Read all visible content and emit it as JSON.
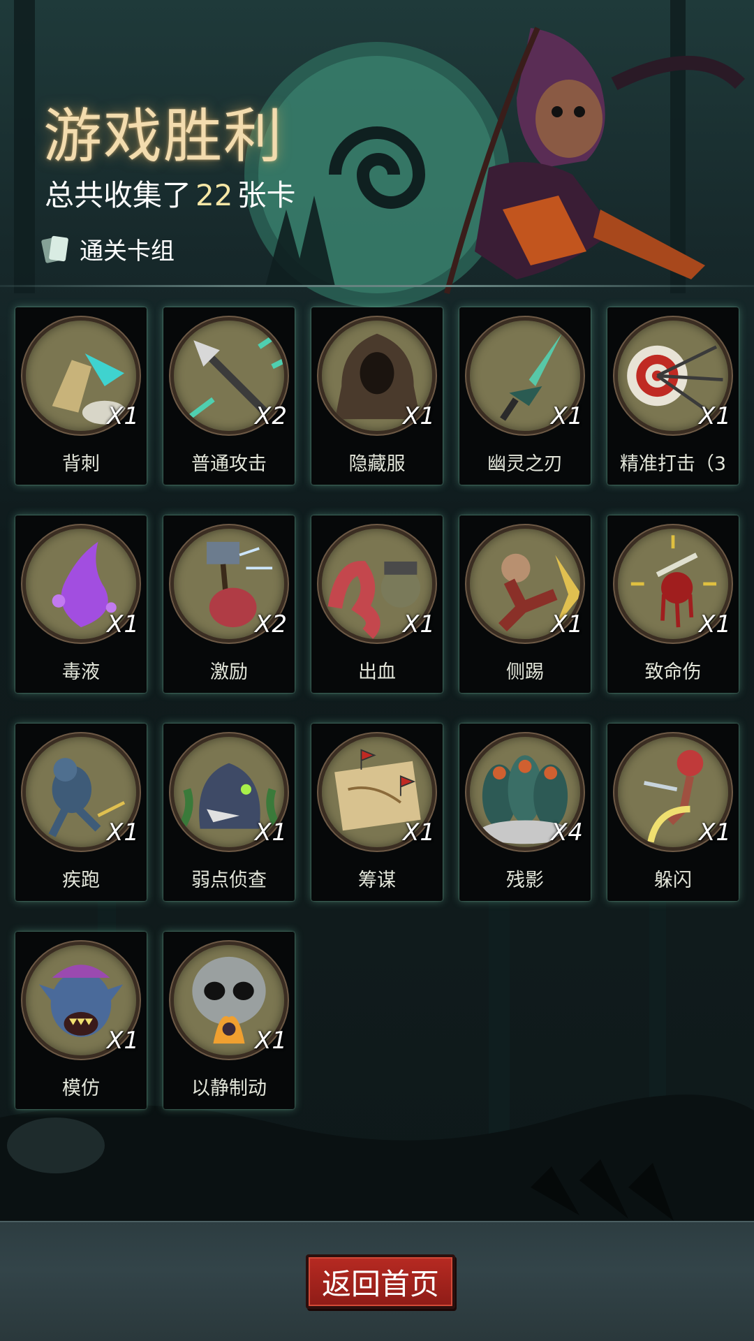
{
  "result": {
    "title": "游戏胜利",
    "summary_prefix": "总共收集了",
    "summary_count": "22",
    "summary_suffix": "张卡",
    "deck_label": "通关卡组"
  },
  "cards": [
    {
      "name": "背刺",
      "qty": "X1",
      "icon": "backstab-icon"
    },
    {
      "name": "普通攻击",
      "qty": "X2",
      "icon": "spear-strike-icon"
    },
    {
      "name": "隐藏服",
      "qty": "X1",
      "icon": "hooded-cloak-icon"
    },
    {
      "name": "幽灵之刃",
      "qty": "X1",
      "icon": "ghost-blade-icon"
    },
    {
      "name": "精准打击（3",
      "qty": "X1",
      "icon": "target-arrows-icon"
    },
    {
      "name": "毒液",
      "qty": "X1",
      "icon": "poison-splash-icon"
    },
    {
      "name": "激励",
      "qty": "X2",
      "icon": "hammer-warrior-icon"
    },
    {
      "name": "出血",
      "qty": "X1",
      "icon": "tentacle-monster-icon"
    },
    {
      "name": "侧踢",
      "qty": "X1",
      "icon": "side-kick-icon"
    },
    {
      "name": "致命伤",
      "qty": "X1",
      "icon": "bleeding-dagger-icon"
    },
    {
      "name": "疾跑",
      "qty": "X1",
      "icon": "sprinting-beast-icon"
    },
    {
      "name": "弱点侦查",
      "qty": "X1",
      "icon": "wolf-head-icon"
    },
    {
      "name": "筹谋",
      "qty": "X1",
      "icon": "battle-map-icon"
    },
    {
      "name": "残影",
      "qty": "X4",
      "icon": "shadow-clones-icon"
    },
    {
      "name": "躲闪",
      "qty": "X1",
      "icon": "dodge-girl-icon"
    },
    {
      "name": "模仿",
      "qty": "X1",
      "icon": "goblin-face-icon"
    },
    {
      "name": "以静制动",
      "qty": "X1",
      "icon": "skull-flame-icon"
    }
  ],
  "footer": {
    "home_button": "返回首页"
  },
  "colors": {
    "title_glow": "#f3dcae",
    "card_bg": "#060809",
    "art_bg": "#7b7651",
    "button_red": "#b72a22"
  }
}
